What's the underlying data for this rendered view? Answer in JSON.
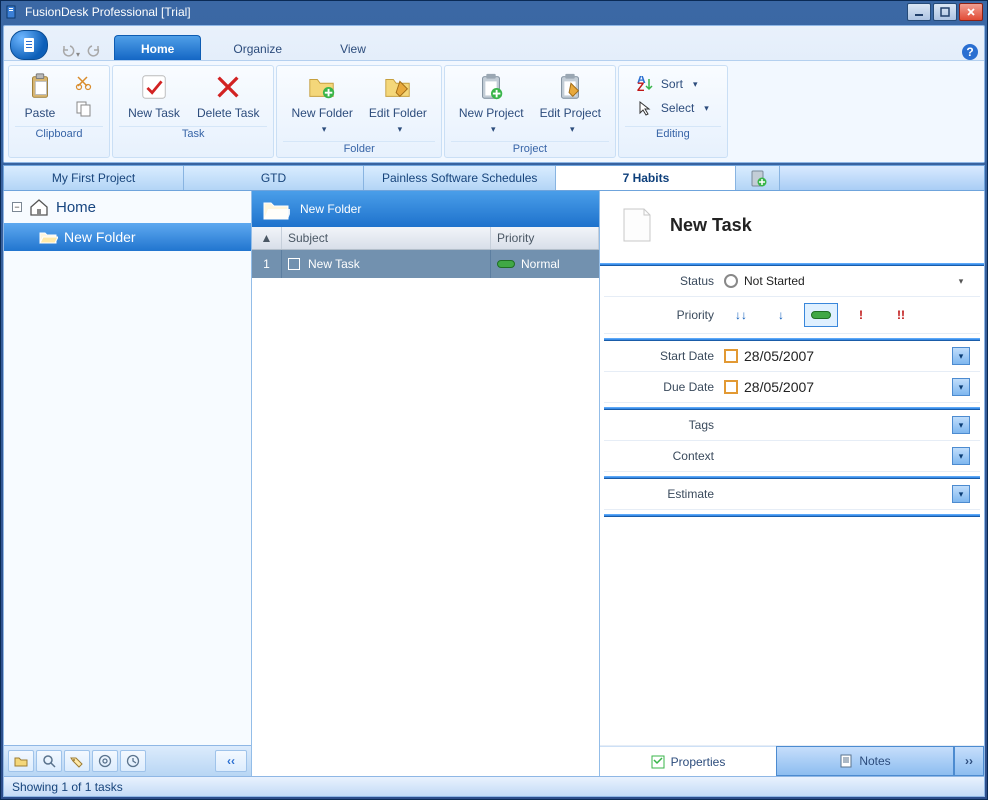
{
  "window": {
    "title": "FusionDesk Professional [Trial]"
  },
  "ribbon": {
    "tabs": {
      "home": "Home",
      "organize": "Organize",
      "view": "View"
    },
    "clipboard": {
      "paste": "Paste",
      "group": "Clipboard"
    },
    "task": {
      "new": "New Task",
      "delete": "Delete Task",
      "group": "Task"
    },
    "folder": {
      "new": "New Folder",
      "edit": "Edit Folder",
      "group": "Folder"
    },
    "project": {
      "new": "New Project",
      "edit": "Edit Project",
      "group": "Project"
    },
    "editing": {
      "sort": "Sort",
      "select": "Select",
      "group": "Editing"
    }
  },
  "projectTabs": {
    "t0": "My First Project",
    "t1": "GTD",
    "t2": "Painless Software Schedules",
    "t3": "7 Habits"
  },
  "tree": {
    "home": "Home",
    "folder1": "New Folder"
  },
  "list": {
    "title": "New Folder",
    "col_subject": "Subject",
    "col_priority": "Priority",
    "row1_idx": "1",
    "row1_subject": "New Task",
    "row1_priority": "Normal"
  },
  "detail": {
    "title": "New Task",
    "status_label": "Status",
    "status_value": "Not Started",
    "priority_label": "Priority",
    "start_label": "Start Date",
    "start_value": "28/05/2007",
    "due_label": "Due Date",
    "due_value": "28/05/2007",
    "tags_label": "Tags",
    "context_label": "Context",
    "estimate_label": "Estimate",
    "properties_tab": "Properties",
    "notes_tab": "Notes"
  },
  "status": {
    "text": "Showing 1 of 1 tasks"
  }
}
